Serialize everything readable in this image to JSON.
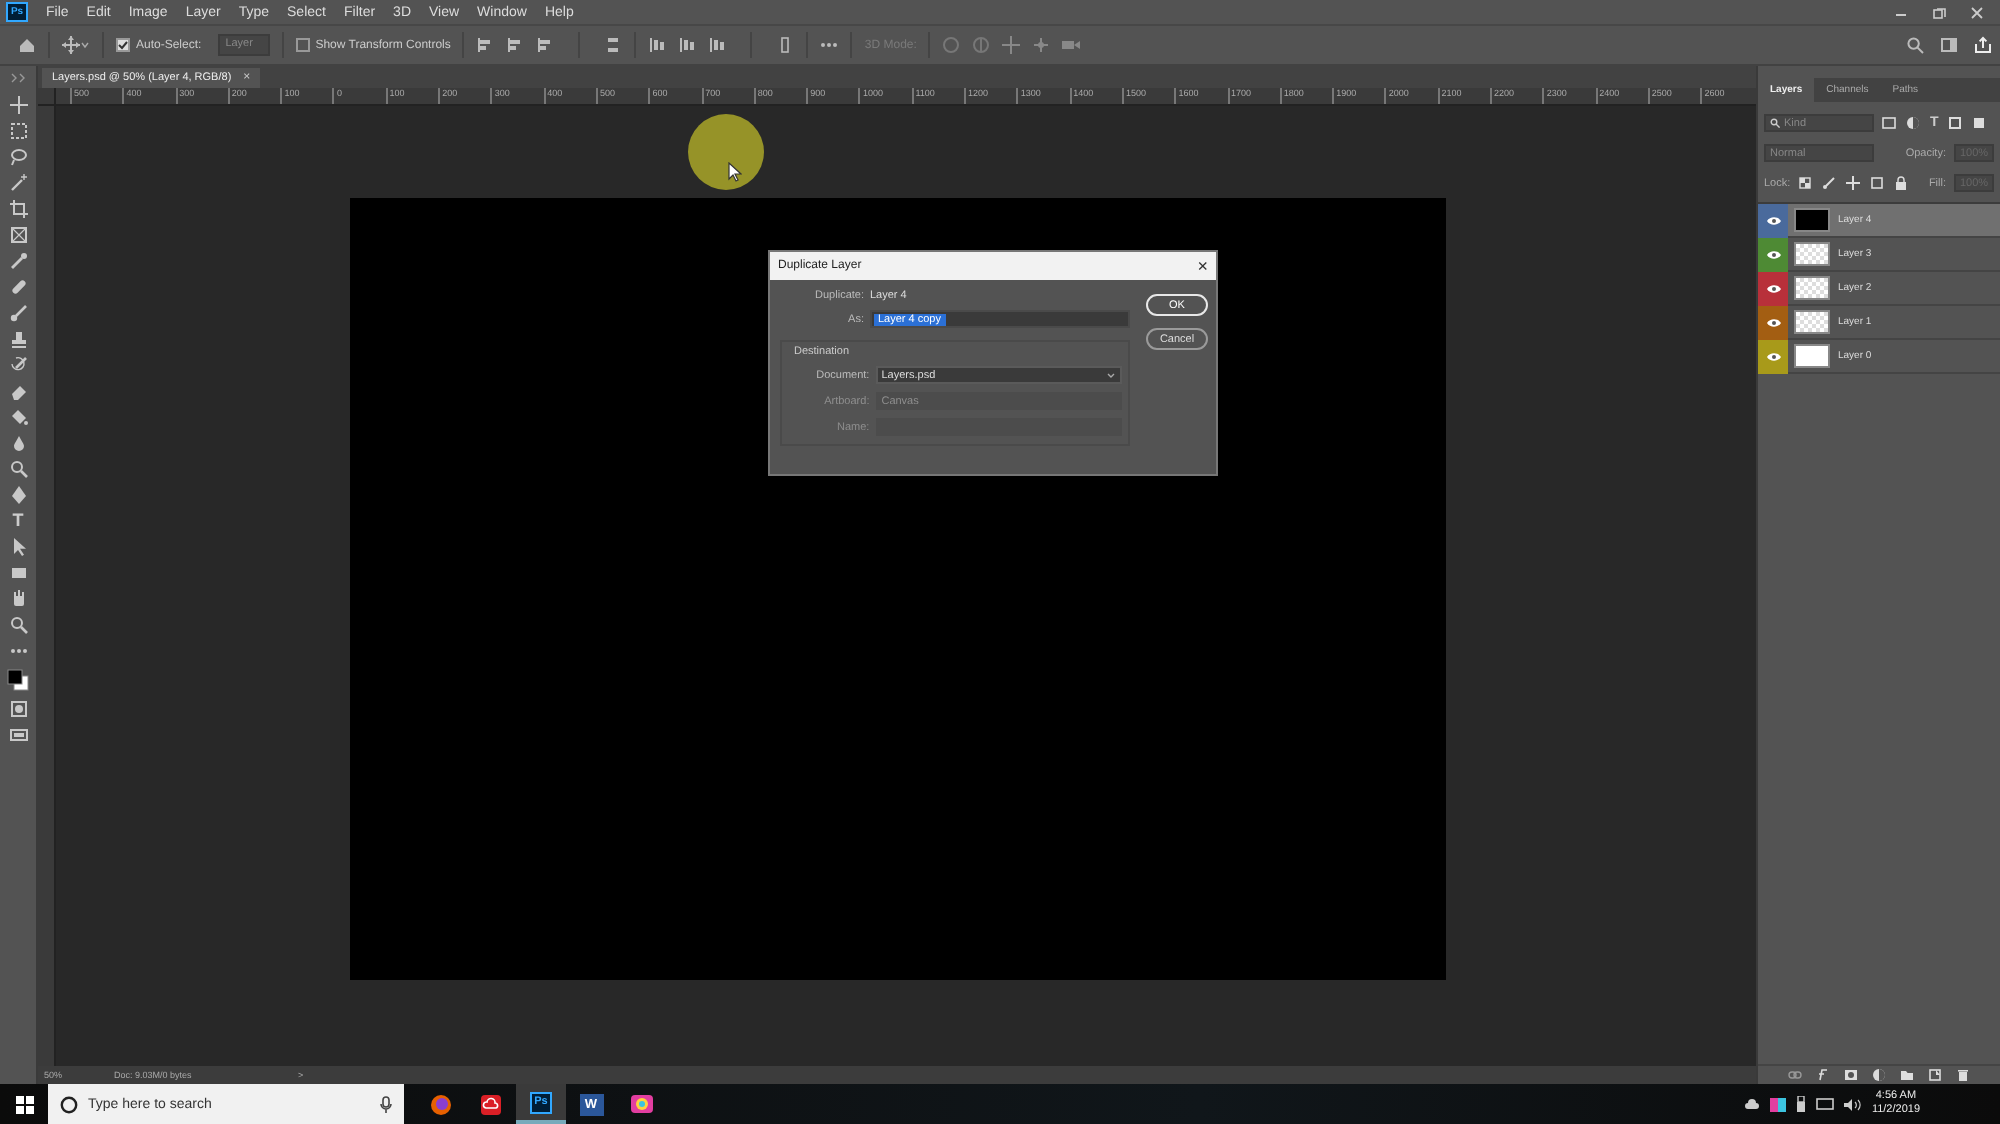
{
  "app": {
    "logo": "Ps",
    "menu": [
      "File",
      "Edit",
      "Image",
      "Layer",
      "Type",
      "Select",
      "Filter",
      "3D",
      "View",
      "Window",
      "Help"
    ]
  },
  "options_bar": {
    "auto_select": {
      "label": "Auto-Select:",
      "checked": true
    },
    "target": {
      "value": "Layer"
    },
    "transform_controls": {
      "label": "Show Transform Controls",
      "checked": false
    },
    "mode_label": "3D Mode:"
  },
  "document_tab": {
    "title": "Layers.psd @ 50% (Layer 4, RGB/8)",
    "close": "×"
  },
  "toolbar": {
    "type_tool": "T"
  },
  "ruler": {
    "labels": [
      "500",
      "400",
      "300",
      "200",
      "100",
      "0",
      "100",
      "200",
      "300",
      "400",
      "500",
      "600",
      "700",
      "800",
      "900",
      "1000",
      "1100",
      "1200",
      "1300",
      "1400",
      "1500",
      "1600",
      "1700",
      "1800",
      "1900",
      "2000",
      "2100",
      "2200",
      "2300",
      "2400",
      "2500",
      "2600"
    ]
  },
  "dialog": {
    "title": "Duplicate Layer",
    "close": "×",
    "duplicate_label": "Duplicate:",
    "duplicate_value": "Layer 4",
    "as_label": "As:",
    "as_value": "Layer 4 copy",
    "destination_title": "Destination",
    "fields": [
      {
        "label": "Document:",
        "value": "Layers.psd",
        "disabled": false
      },
      {
        "label": "Artboard:",
        "value": "Canvas",
        "disabled": true
      },
      {
        "label": "Name:",
        "disabled": true
      }
    ],
    "buttons": [
      {
        "label": "OK",
        "default": true
      },
      {
        "label": "Cancel",
        "default": false
      }
    ]
  },
  "status_bar": {
    "zoom": "50%",
    "info": "Doc: 9.03M/0 bytes",
    "arrow": ">"
  },
  "layers_panel": {
    "tabs": [
      {
        "label": "Layers",
        "selected": true
      },
      {
        "label": "Channels",
        "selected": false
      },
      {
        "label": "Paths",
        "selected": false
      }
    ],
    "filter_placeholder": "Kind",
    "type_filter": "T",
    "blend_mode": "Normal",
    "opacity_label": "Opacity:",
    "opacity_value": "100%",
    "lock_label": "Lock:",
    "fill_label": "Fill:",
    "fill_value": "100%",
    "layers": [
      {
        "name": "Layer 4",
        "kind": "black",
        "color": "#4a6a9c",
        "visible": true,
        "selected": true
      },
      {
        "name": "Layer 3",
        "kind": "transparent",
        "color": "#4e8a34",
        "visible": true,
        "selected": false
      },
      {
        "name": "Layer 2",
        "kind": "transparent",
        "color": "#b8303a",
        "visible": true,
        "selected": false
      },
      {
        "name": "Layer 1",
        "kind": "transparent",
        "color": "#a35e12",
        "visible": true,
        "selected": false
      },
      {
        "name": "Layer 0",
        "kind": "white",
        "color": "#a89a1a",
        "visible": true,
        "selected": false
      }
    ]
  },
  "taskbar": {
    "search_placeholder": "Type here to search",
    "apps": [
      {
        "kind": "fox",
        "active": false
      },
      {
        "kind": "cloud",
        "active": false
      },
      {
        "kind": "ps",
        "label": "Ps",
        "active": true
      },
      {
        "kind": "doc",
        "label": "W",
        "active": false
      },
      {
        "kind": "palette",
        "active": false
      }
    ],
    "time": "4:56 AM",
    "date": "11/2/2019"
  }
}
